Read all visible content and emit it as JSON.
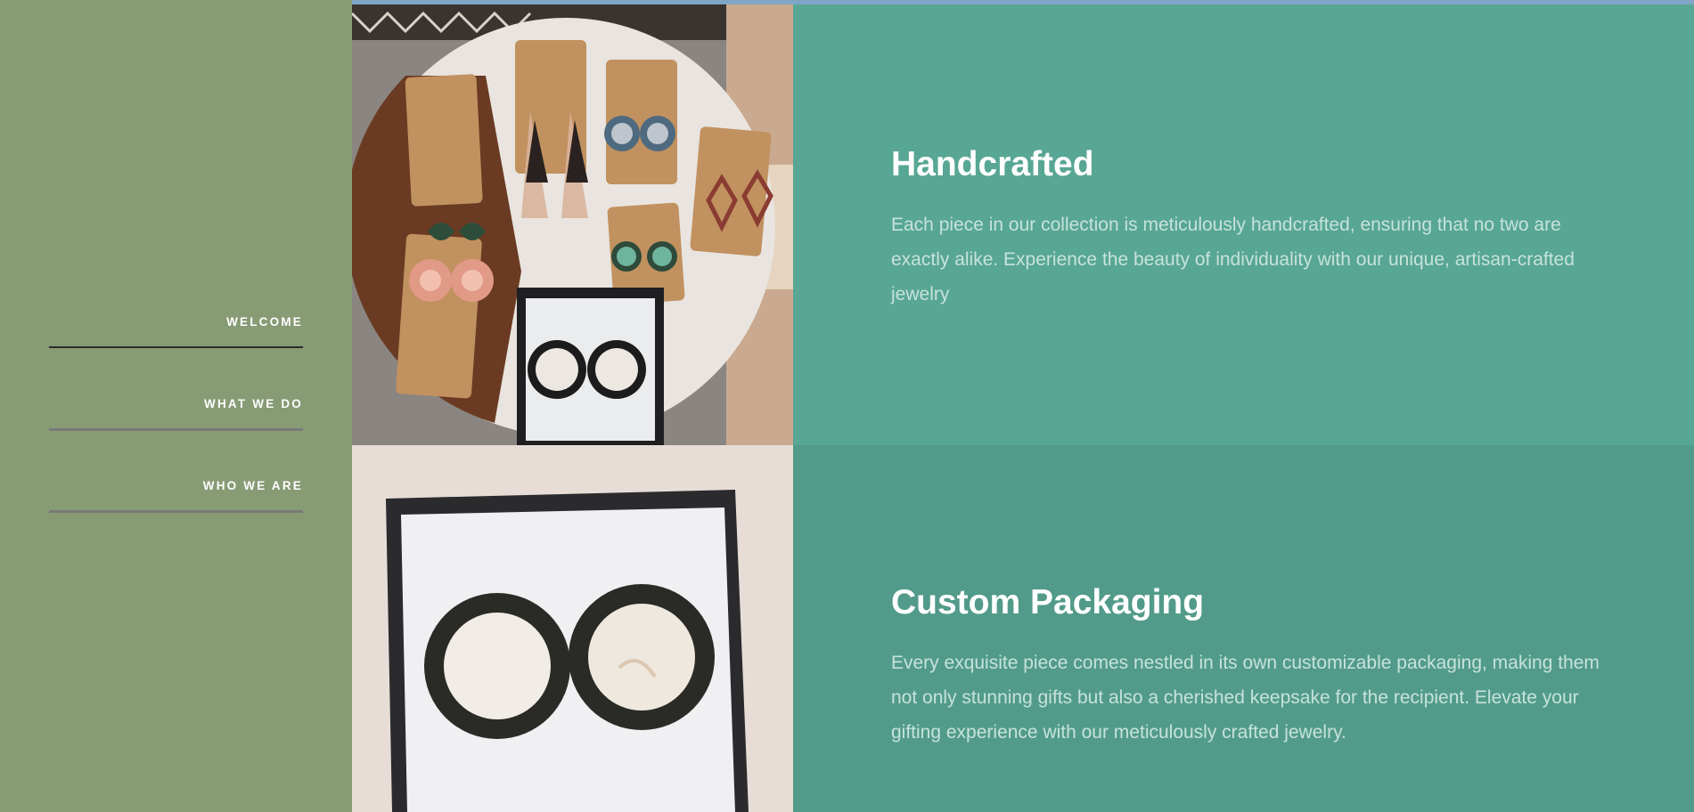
{
  "nav": {
    "items": [
      {
        "label": "WELCOME",
        "active": true
      },
      {
        "label": "WHAT WE DO",
        "active": false
      },
      {
        "label": "WHO WE ARE",
        "active": false
      }
    ]
  },
  "sections": [
    {
      "heading": "Handcrafted",
      "body": "Each piece in our collection is meticulously handcrafted, ensuring that no two are exactly alike. Experience the beauty of individuality with our unique, artisan-crafted jewelry"
    },
    {
      "heading": "Custom Packaging",
      "body": "Every exquisite piece comes nestled in its own customizable packaging, making them not only stunning gifts but also a cherished keepsake for the recipient. Elevate your gifting experience with our meticulously crafted jewelry."
    }
  ],
  "colors": {
    "sidebar": "#879b74",
    "section1": "#58a694",
    "section2": "#529b8a",
    "topbar": "#7fa6c6",
    "heading": "#ffffff",
    "body_text": "#c6e3da"
  }
}
